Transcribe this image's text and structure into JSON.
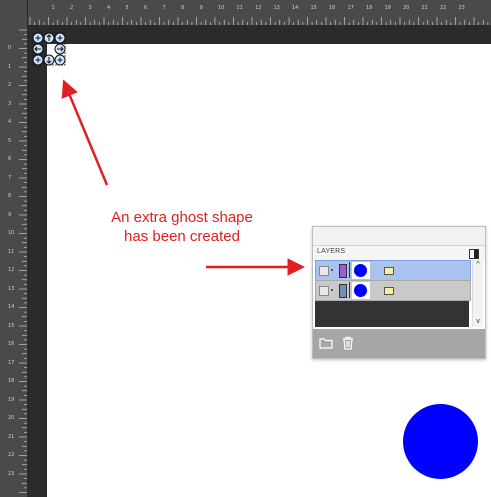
{
  "ruler": {
    "top_numbers": [
      "1",
      "2",
      "3",
      "4",
      "5",
      "6",
      "7",
      "8",
      "9",
      "10",
      "11",
      "12",
      "13",
      "14",
      "15",
      "16",
      "17",
      "18",
      "19",
      "20",
      "21",
      "22",
      "23"
    ],
    "left_numbers": [
      "0",
      "1",
      "2",
      "3",
      "4",
      "5",
      "6",
      "7",
      "8",
      "9",
      "10",
      "11",
      "12",
      "13",
      "14",
      "15",
      "16",
      "17",
      "18",
      "19",
      "20",
      "21",
      "22",
      "23"
    ]
  },
  "annotation": {
    "line1": "An extra ghost shape",
    "line2": "has been created",
    "color": "#e02020"
  },
  "layers_panel": {
    "title": "LAYERS",
    "rows": [
      {
        "state": "selected",
        "swatch_color": "#9a5fd0",
        "thumb_shape": "blue-circle"
      },
      {
        "state": "normal",
        "swatch_color": "#6f8fb7",
        "thumb_shape": "blue-circle"
      }
    ],
    "scroll_up": "^",
    "scroll_down": "v",
    "footer_icons": [
      "folder-icon",
      "trash-icon"
    ]
  },
  "canvas_shape": {
    "type": "circle",
    "color": "#0000ff"
  }
}
